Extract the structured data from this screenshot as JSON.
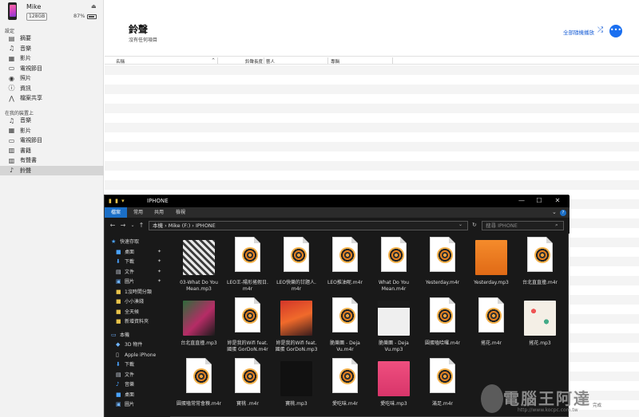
{
  "device": {
    "name": "Mike",
    "capacity": "128GB",
    "battery": "87%"
  },
  "sidebar": {
    "settings_header": "設定",
    "settings_items": [
      {
        "label": "摘要",
        "icon": "summary-icon",
        "glyph": "▤"
      },
      {
        "label": "音樂",
        "icon": "music-note-icon",
        "glyph": "♫"
      },
      {
        "label": "影片",
        "icon": "film-icon",
        "glyph": "▦"
      },
      {
        "label": "電視節目",
        "icon": "tv-icon",
        "glyph": "▭"
      },
      {
        "label": "照片",
        "icon": "camera-icon",
        "glyph": "◉"
      },
      {
        "label": "資訊",
        "icon": "info-icon",
        "glyph": "ⓘ"
      },
      {
        "label": "檔案共享",
        "icon": "file-share-icon",
        "glyph": "⋀"
      }
    ],
    "device_header": "在我的裝置上",
    "device_items": [
      {
        "label": "音樂",
        "icon": "music-note-icon",
        "glyph": "♫"
      },
      {
        "label": "影片",
        "icon": "film-icon",
        "glyph": "▦"
      },
      {
        "label": "電視節目",
        "icon": "tv-icon",
        "glyph": "▭"
      },
      {
        "label": "書籍",
        "icon": "book-icon",
        "glyph": "▥"
      },
      {
        "label": "有聲書",
        "icon": "audiobook-icon",
        "glyph": "▥"
      },
      {
        "label": "鈴聲",
        "icon": "bell-icon",
        "glyph": "♪"
      }
    ]
  },
  "main": {
    "title": "鈴聲",
    "subtitle": "沒有任何項目",
    "shuffle_label": "全部隨機播放",
    "more_label": "•••",
    "columns": [
      "名稱",
      "鈴聲長度",
      "藝人",
      "專輯"
    ]
  },
  "explorer": {
    "title": "IPHONE",
    "tabs": [
      "檔案",
      "常用",
      "共用",
      "檢視"
    ],
    "address": "本機 › Mike (F:) › IPHONE",
    "search_placeholder": "搜尋 IPHONE",
    "tree": [
      {
        "label": "快速存取",
        "icon": "star-icon",
        "glyph": "★",
        "indent": 0,
        "pinned": false,
        "color": "#4aa3ff"
      },
      {
        "label": "桌面",
        "icon": "desktop-icon",
        "glyph": "■",
        "indent": 1,
        "pinned": true,
        "color": "#4aa3ff"
      },
      {
        "label": "下載",
        "icon": "download-icon",
        "glyph": "⬇",
        "indent": 1,
        "pinned": true,
        "color": "#4aa3ff"
      },
      {
        "label": "文件",
        "icon": "document-icon",
        "glyph": "▤",
        "indent": 1,
        "pinned": true,
        "color": "#cfd8e6"
      },
      {
        "label": "圖片",
        "icon": "picture-icon",
        "glyph": "▣",
        "indent": 1,
        "pinned": true,
        "color": "#6fb4ff"
      },
      {
        "label": "1沒時間分類",
        "icon": "folder-icon",
        "glyph": "■",
        "indent": 1,
        "pinned": false,
        "color": "#e8c34a"
      },
      {
        "label": "小小湊錢",
        "icon": "folder-icon",
        "glyph": "■",
        "indent": 1,
        "pinned": false,
        "color": "#e8c34a"
      },
      {
        "label": "全天候",
        "icon": "folder-icon",
        "glyph": "■",
        "indent": 1,
        "pinned": false,
        "color": "#e8c34a"
      },
      {
        "label": "新增資料夾",
        "icon": "folder-icon",
        "glyph": "■",
        "indent": 1,
        "pinned": false,
        "color": "#e8c34a"
      },
      {
        "label": "本機",
        "icon": "computer-icon",
        "glyph": "▭",
        "indent": 0,
        "pinned": false,
        "color": "#6fb4ff"
      },
      {
        "label": "3D 物件",
        "icon": "cube-icon",
        "glyph": "◆",
        "indent": 1,
        "pinned": false,
        "color": "#6fb4ff"
      },
      {
        "label": "Apple iPhone",
        "icon": "phone-icon",
        "glyph": "▯",
        "indent": 1,
        "pinned": false,
        "color": "#cccccc"
      },
      {
        "label": "下載",
        "icon": "download-icon",
        "glyph": "⬇",
        "indent": 1,
        "pinned": false,
        "color": "#4aa3ff"
      },
      {
        "label": "文件",
        "icon": "document-icon",
        "glyph": "▤",
        "indent": 1,
        "pinned": false,
        "color": "#cfd8e6"
      },
      {
        "label": "音樂",
        "icon": "music-note-icon",
        "glyph": "♪",
        "indent": 1,
        "pinned": false,
        "color": "#4aa3ff"
      },
      {
        "label": "桌面",
        "icon": "desktop-icon",
        "glyph": "■",
        "indent": 1,
        "pinned": false,
        "color": "#4aa3ff"
      },
      {
        "label": "圖片",
        "icon": "picture-icon",
        "glyph": "▣",
        "indent": 1,
        "pinned": false,
        "color": "#6fb4ff"
      }
    ],
    "files": [
      {
        "name": "03-What Do You\nMean.mp3",
        "kind": "art",
        "art": "bw"
      },
      {
        "name": "LEO王-陽形搖假日.\nm4r",
        "kind": "doc"
      },
      {
        "name": "LEO快樂的甘題人.\nm4r",
        "kind": "doc"
      },
      {
        "name": "LEO推油呢.m4r",
        "kind": "doc"
      },
      {
        "name": "What Do You\nMean.m4r",
        "kind": "doc"
      },
      {
        "name": "Yesterday.m4r",
        "kind": "doc"
      },
      {
        "name": "Yesterday.mp3",
        "kind": "art",
        "art": "orange"
      },
      {
        "name": "台北直直撞.m4r",
        "kind": "doc"
      },
      {
        "name": "台北直直撞.mp3",
        "kind": "art",
        "art": "graffiti"
      },
      {
        "name": "妳是我的Wifi feat.\n國蛋 GorDoN.m4r",
        "kind": "doc"
      },
      {
        "name": "妳是我的Wifi feat.\n國蛋 GorDoN.mp3",
        "kind": "art",
        "art": "red"
      },
      {
        "name": "脆樂團 - Deja\nVu.m4r",
        "kind": "doc"
      },
      {
        "name": "脆樂團 - Deja\nVu.mp3",
        "kind": "art",
        "art": "portrait"
      },
      {
        "name": "圓蛋嗑哈囉.m4r",
        "kind": "doc"
      },
      {
        "name": "搖花.m4r",
        "kind": "doc"
      },
      {
        "name": "搖花.mp3",
        "kind": "art",
        "art": "pattern"
      },
      {
        "name": "圓蛋嗑常常會糗.m4r",
        "kind": "doc"
      },
      {
        "name": "寶桃 .m4r",
        "kind": "doc"
      },
      {
        "name": "寶桃.mp3",
        "kind": "art",
        "art": "gold"
      },
      {
        "name": "愛吃味.m4r",
        "kind": "doc"
      },
      {
        "name": "愛吃味.mp3",
        "kind": "art",
        "art": "pink"
      },
      {
        "name": "滿足.m4r",
        "kind": "doc"
      }
    ]
  },
  "watermark": {
    "text": "電腦王阿達",
    "url": "http://www.kocpc.com.tw"
  },
  "done_label": "完成"
}
